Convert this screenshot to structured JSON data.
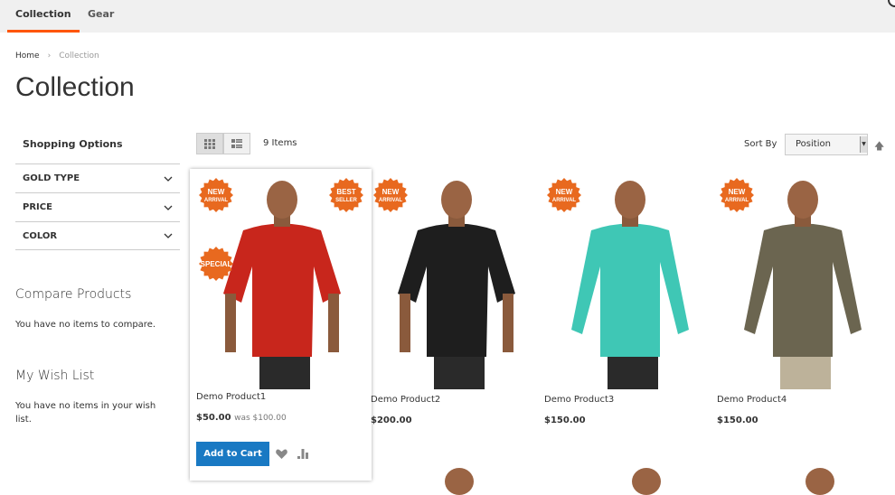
{
  "nav": {
    "tabs": [
      {
        "label": "Collection",
        "active": true
      },
      {
        "label": "Gear",
        "active": false
      }
    ]
  },
  "breadcrumb": {
    "home": "Home",
    "separator": "›",
    "current": "Collection"
  },
  "page_title": "Collection",
  "sidebar": {
    "title": "Shopping Options",
    "filters": [
      {
        "label": "GOLD TYPE"
      },
      {
        "label": "PRICE"
      },
      {
        "label": "COLOR"
      }
    ],
    "compare": {
      "title": "Compare Products",
      "text": "You have no items to compare."
    },
    "wishlist": {
      "title": "My Wish List",
      "text": "You have no items in your wish list."
    }
  },
  "toolbar": {
    "count": "9 Items",
    "sort_label": "Sort By",
    "sort_value": "Position",
    "modes": [
      "grid",
      "list"
    ]
  },
  "badges": {
    "new": [
      "NEW",
      "ARRIVAL"
    ],
    "best": [
      "BEST",
      "SELLER"
    ],
    "special": [
      "SPECIAL"
    ]
  },
  "products": [
    {
      "name": "Demo Product1",
      "price": "$50.00",
      "was": "was $100.00",
      "shirt": "#c8261c",
      "badges": [
        "new",
        "best",
        "special"
      ]
    },
    {
      "name": "Demo Product2",
      "price": "$200.00",
      "shirt": "#1e1e1e",
      "badges": [
        "new"
      ]
    },
    {
      "name": "Demo Product3",
      "price": "$150.00",
      "shirt": "#3fc7b5",
      "badges": [
        "new"
      ]
    },
    {
      "name": "Demo Product4",
      "price": "$150.00",
      "shirt": "#6b6550",
      "badges": [
        "new"
      ]
    }
  ],
  "actions": {
    "add_to_cart": "Add to Cart"
  },
  "colors": {
    "accent": "#ff5501",
    "primary_button": "#1979c3",
    "badge": "#e8691f"
  }
}
